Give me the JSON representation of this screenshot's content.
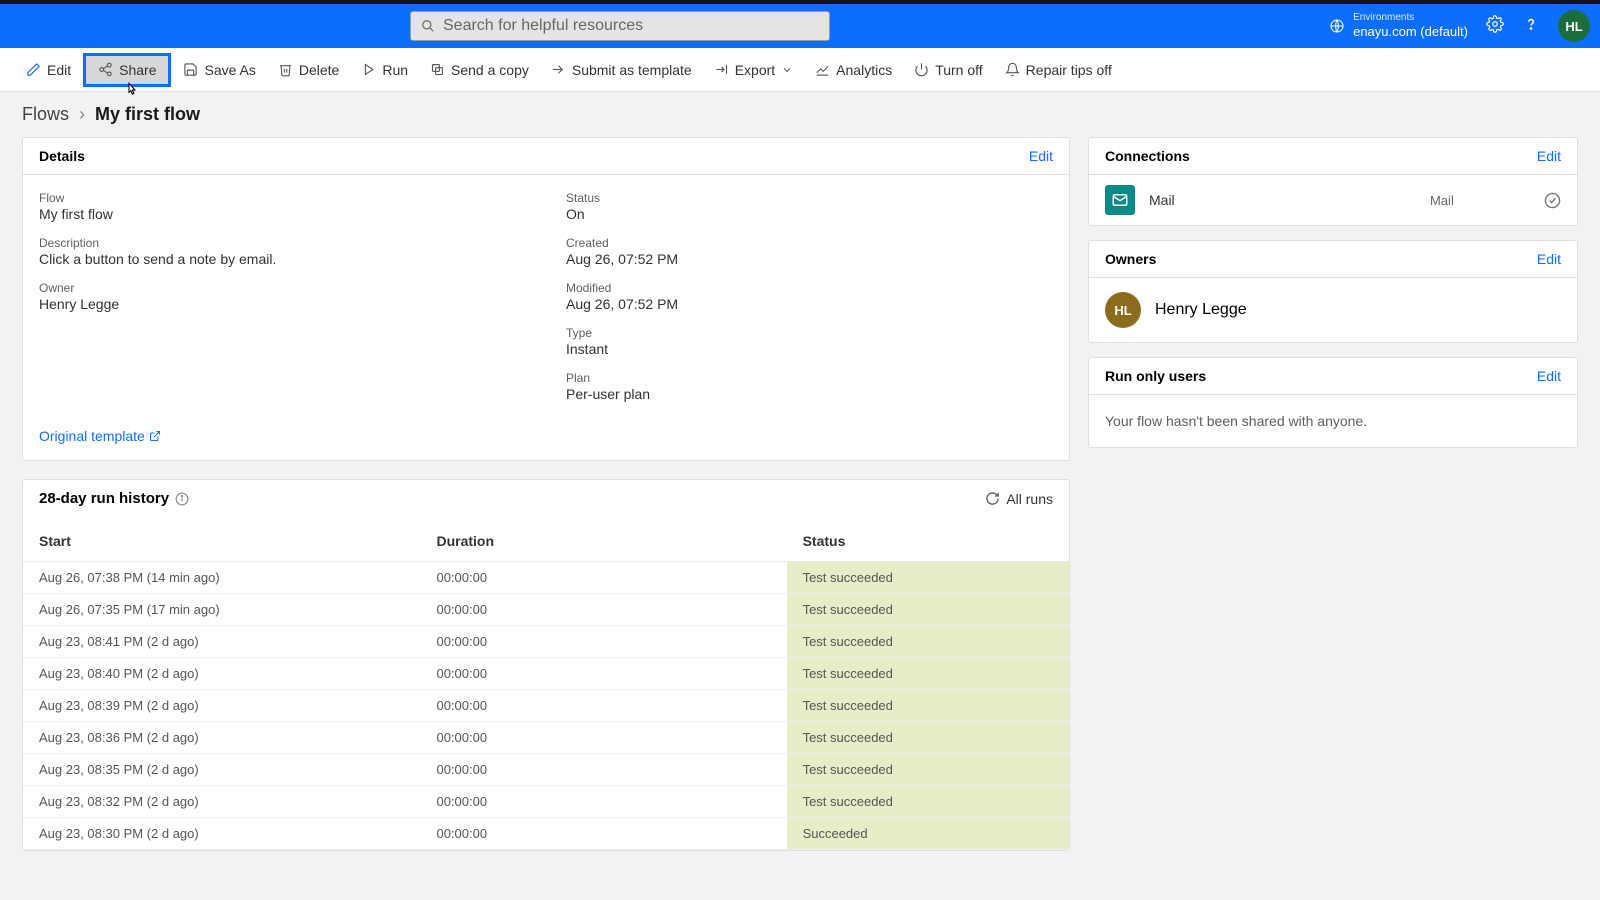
{
  "topbar": {
    "search_placeholder": "Search for helpful resources",
    "env_label": "Environments",
    "env_value": "enayu.com (default)",
    "avatar_initials": "HL"
  },
  "commands": {
    "edit": "Edit",
    "share": "Share",
    "saveas": "Save As",
    "delete": "Delete",
    "run": "Run",
    "sendcopy": "Send a copy",
    "submit": "Submit as template",
    "export": "Export",
    "analytics": "Analytics",
    "turnoff": "Turn off",
    "repair": "Repair tips off"
  },
  "breadcrumb": {
    "root": "Flows",
    "current": "My first flow"
  },
  "details": {
    "title": "Details",
    "edit": "Edit",
    "flow_lbl": "Flow",
    "flow_val": "My first flow",
    "desc_lbl": "Description",
    "desc_val": "Click a button to send a note by email.",
    "owner_lbl": "Owner",
    "owner_val": "Henry Legge",
    "status_lbl": "Status",
    "status_val": "On",
    "created_lbl": "Created",
    "created_val": "Aug 26, 07:52 PM",
    "modified_lbl": "Modified",
    "modified_val": "Aug 26, 07:52 PM",
    "type_lbl": "Type",
    "type_val": "Instant",
    "plan_lbl": "Plan",
    "plan_val": "Per-user plan",
    "template_link": "Original template"
  },
  "history": {
    "title": "28-day run history",
    "allruns": "All runs",
    "col_start": "Start",
    "col_duration": "Duration",
    "col_status": "Status",
    "rows": [
      {
        "start": "Aug 26, 07:38 PM (14 min ago)",
        "dur": "00:00:00",
        "status": "Test succeeded"
      },
      {
        "start": "Aug 26, 07:35 PM (17 min ago)",
        "dur": "00:00:00",
        "status": "Test succeeded"
      },
      {
        "start": "Aug 23, 08:41 PM (2 d ago)",
        "dur": "00:00:00",
        "status": "Test succeeded"
      },
      {
        "start": "Aug 23, 08:40 PM (2 d ago)",
        "dur": "00:00:00",
        "status": "Test succeeded"
      },
      {
        "start": "Aug 23, 08:39 PM (2 d ago)",
        "dur": "00:00:00",
        "status": "Test succeeded"
      },
      {
        "start": "Aug 23, 08:36 PM (2 d ago)",
        "dur": "00:00:00",
        "status": "Test succeeded"
      },
      {
        "start": "Aug 23, 08:35 PM (2 d ago)",
        "dur": "00:00:00",
        "status": "Test succeeded"
      },
      {
        "start": "Aug 23, 08:32 PM (2 d ago)",
        "dur": "00:00:00",
        "status": "Test succeeded"
      },
      {
        "start": "Aug 23, 08:30 PM (2 d ago)",
        "dur": "00:00:00",
        "status": "Succeeded"
      }
    ]
  },
  "connections": {
    "title": "Connections",
    "edit": "Edit",
    "name": "Mail",
    "type": "Mail"
  },
  "owners": {
    "title": "Owners",
    "edit": "Edit",
    "name": "Henry Legge",
    "initials": "HL"
  },
  "runonly": {
    "title": "Run only users",
    "edit": "Edit",
    "empty": "Your flow hasn't been shared with anyone."
  }
}
